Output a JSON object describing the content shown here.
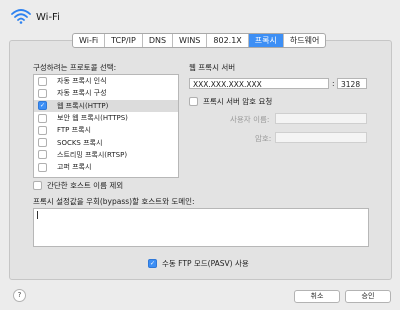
{
  "window": {
    "title": "Wi-Fi"
  },
  "tabs": [
    {
      "label": "Wi-Fi",
      "active": false
    },
    {
      "label": "TCP/IP",
      "active": false
    },
    {
      "label": "DNS",
      "active": false
    },
    {
      "label": "WINS",
      "active": false
    },
    {
      "label": "802.1X",
      "active": false
    },
    {
      "label": "프록시",
      "active": true
    },
    {
      "label": "하드웨어",
      "active": false
    }
  ],
  "protocols": {
    "heading": "구성하려는 프로토콜 선택:",
    "items": [
      {
        "label": "자동 프록시 인식",
        "checked": false
      },
      {
        "label": "자동 프록시 구성",
        "checked": false
      },
      {
        "label": "웹 프록시(HTTP)",
        "checked": true
      },
      {
        "label": "보안 웹 프록시(HTTPS)",
        "checked": false
      },
      {
        "label": "FTP 프록시",
        "checked": false
      },
      {
        "label": "SOCKS 프록시",
        "checked": false
      },
      {
        "label": "스트리밍 프록시(RTSP)",
        "checked": false
      },
      {
        "label": "고퍼 프록시",
        "checked": false
      }
    ]
  },
  "exclude_simple_hosts": {
    "label": "간단한 호스트 이름 제외",
    "checked": false
  },
  "proxy_server": {
    "heading": "웹 프록시 서버",
    "host": "XXX.XXX.XXX.XXX",
    "separator": ":",
    "port": "3128",
    "require_password": {
      "label": "프록시 서버 암호 요청",
      "checked": false
    },
    "username_label": "사용자 이름:",
    "password_label": "암호:"
  },
  "bypass": {
    "heading": "프록시 설정값을 우회(bypass)할 호스트와 도메인:",
    "value": ""
  },
  "passive_ftp": {
    "label": "수동 FTP 모드(PASV) 사용",
    "checked": true
  },
  "buttons": {
    "help": "?",
    "cancel": "취소",
    "ok": "승인"
  },
  "colors": {
    "accent": "#3d8ff5",
    "background": "#ececec"
  }
}
